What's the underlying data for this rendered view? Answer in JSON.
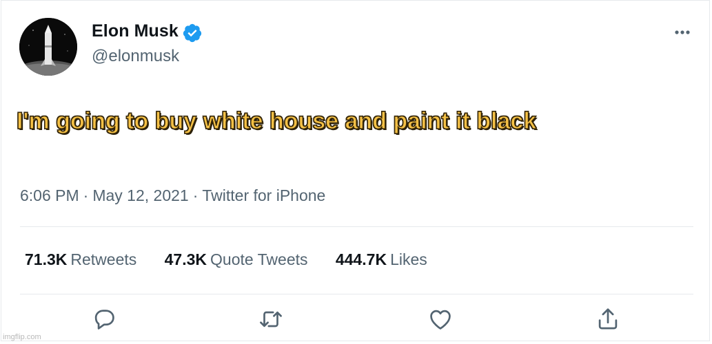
{
  "author": {
    "display_name": "Elon Musk",
    "handle": "@elonmusk",
    "verified": true
  },
  "tweet": {
    "text": "I'm going to buy white house and paint it black",
    "time": "6:06 PM",
    "date": "May 12, 2021",
    "source": "Twitter for iPhone",
    "separator": "·"
  },
  "stats": {
    "retweets_count": "71.3K",
    "retweets_label": "Retweets",
    "quotes_count": "47.3K",
    "quotes_label": "Quote Tweets",
    "likes_count": "444.7K",
    "likes_label": "Likes"
  },
  "actions": {
    "reply_icon": "reply-icon",
    "retweet_icon": "retweet-icon",
    "like_icon": "heart-icon",
    "share_icon": "share-icon"
  },
  "watermark": "imgflip.com",
  "colors": {
    "verified_badge": "#1d9bf0",
    "secondary_text": "#536471",
    "primary_text": "#0f1419",
    "tweet_text_fill": "#f5c146"
  }
}
